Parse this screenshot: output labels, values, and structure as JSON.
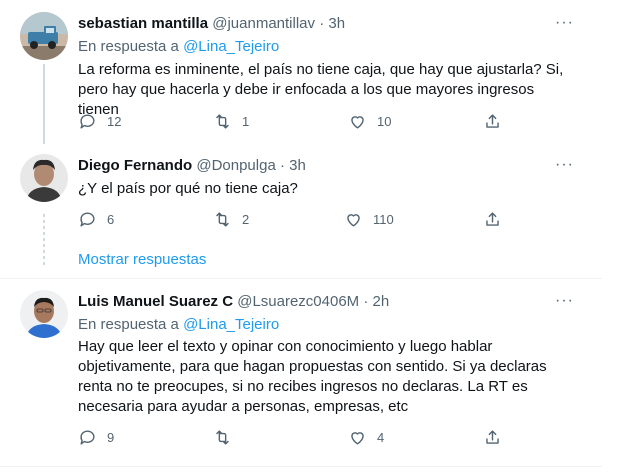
{
  "tweets": [
    {
      "name": "sebastian mantilla",
      "handle": "@juanmantillav",
      "time": "· 3h",
      "reply_prefix": "En respuesta a",
      "reply_to": "@Lina_Tejeiro",
      "text": "La reforma es inminente, el país no tiene caja, que hay que ajustarla? Si, pero hay que hacerla y debe ir enfocada a los que mayores ingresos tienen",
      "replies": "12",
      "retweets": "1",
      "likes": "10",
      "more_icon": "···"
    },
    {
      "name": "Diego Fernando",
      "handle": "@Donpulga",
      "time": "· 3h",
      "text": "¿Y el país por qué no tiene caja?",
      "replies": "6",
      "retweets": "2",
      "likes": "110",
      "more_icon": "···"
    },
    {
      "name": "Luis Manuel Suarez C",
      "handle": "@Lsuarezc0406M",
      "time": "· 2h",
      "reply_prefix": "En respuesta a",
      "reply_to": "@Lina_Tejeiro",
      "text": "Hay que leer el texto y opinar con conocimiento y luego hablar objetivamente, para que hagan propuestas con sentido. Si ya declaras renta no te preocupes, si no recibes ingresos no declaras. La RT es necesaria para ayudar a personas, empresas, etc",
      "replies": "9",
      "retweets": "",
      "likes": "4",
      "more_icon": "···"
    }
  ],
  "show_more": "Mostrar respuestas",
  "colors": {
    "accent": "#1d9bf0",
    "muted": "#536471",
    "text": "#0f1419",
    "thread_line": "#cfd9de"
  },
  "icons": [
    "reply-icon",
    "retweet-icon",
    "like-icon",
    "share-icon",
    "more-icon"
  ]
}
